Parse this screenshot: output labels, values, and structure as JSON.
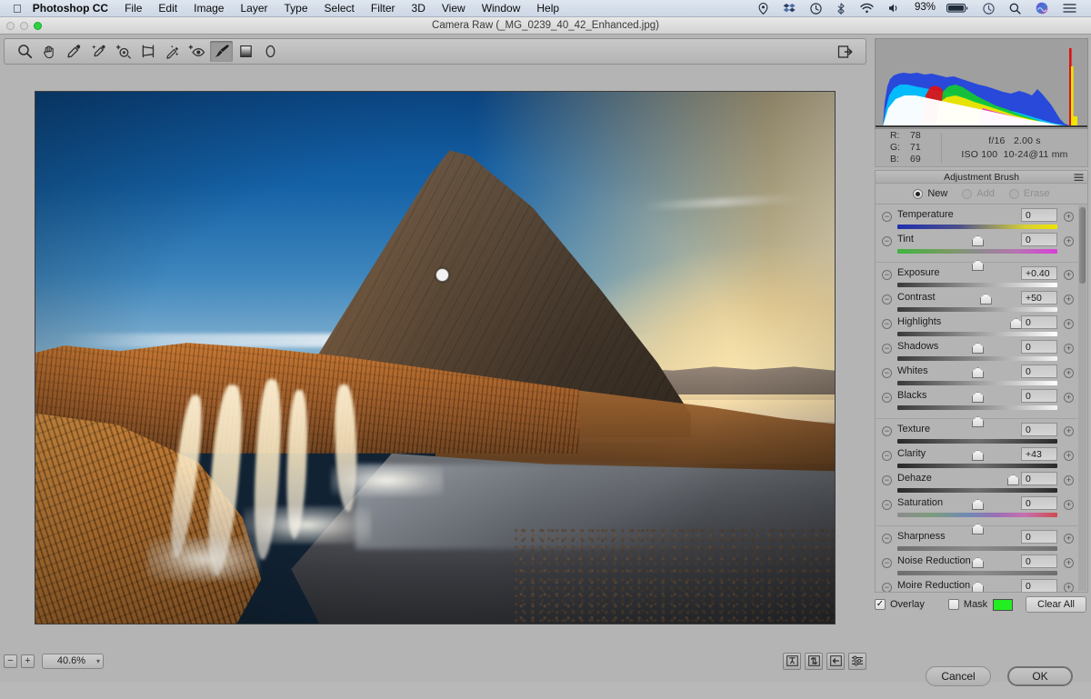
{
  "menubar": {
    "apple_icon": "apple-icon",
    "app_name": "Photoshop CC",
    "items": [
      "File",
      "Edit",
      "Image",
      "Layer",
      "Type",
      "Select",
      "Filter",
      "3D",
      "View",
      "Window",
      "Help"
    ],
    "status": {
      "battery_percent": "93%",
      "icons": [
        "location-icon",
        "dropbox-icon",
        "time-machine-icon",
        "bluetooth-icon",
        "wifi-icon",
        "volume-icon",
        "battery-icon",
        "clock-icon",
        "search-icon",
        "siri-icon",
        "control-center-icon"
      ]
    }
  },
  "window": {
    "title": "Camera Raw (_MG_0239_40_42_Enhanced.jpg)",
    "traffic_lights": [
      "close",
      "minimize",
      "zoom"
    ]
  },
  "toolbar": {
    "tools": [
      {
        "name": "zoom-tool",
        "selected": false
      },
      {
        "name": "hand-tool",
        "selected": false
      },
      {
        "name": "white-balance-tool",
        "selected": false
      },
      {
        "name": "color-sampler-tool",
        "selected": false
      },
      {
        "name": "targeted-adjustment-tool",
        "selected": false
      },
      {
        "name": "crop-tool",
        "selected": false
      },
      {
        "name": "spot-removal-tool",
        "selected": false
      },
      {
        "name": "red-eye-tool",
        "selected": false
      },
      {
        "name": "adjustment-brush-tool",
        "selected": true
      },
      {
        "name": "graduated-filter-tool",
        "selected": false
      },
      {
        "name": "radial-filter-tool",
        "selected": false
      }
    ],
    "preferences_icon": "open-preferences-icon"
  },
  "histogram": {
    "shadow_clip_icon": "shadow-clipping-triangle",
    "highlight_clip_icon": "highlight-clipping-triangle"
  },
  "exif": {
    "r_label": "R:",
    "r_value": "78",
    "g_label": "G:",
    "g_value": "71",
    "b_label": "B:",
    "b_value": "69",
    "aperture": "f/16",
    "shutter": "2.00 s",
    "iso": "ISO 100",
    "lens": "10-24@11 mm"
  },
  "panel": {
    "title": "Adjustment Brush",
    "menu_icon": "panel-menu-icon",
    "modes": [
      {
        "label": "New",
        "selected": true,
        "disabled": false
      },
      {
        "label": "Add",
        "selected": false,
        "disabled": true
      },
      {
        "label": "Erase",
        "selected": false,
        "disabled": true
      }
    ]
  },
  "sliders": [
    [
      {
        "label": "Temperature",
        "value": "0",
        "pos": 50,
        "track": "t-temp"
      },
      {
        "label": "Tint",
        "value": "0",
        "pos": 50,
        "track": "t-tint"
      }
    ],
    [
      {
        "label": "Exposure",
        "value": "+0.40",
        "pos": 55,
        "track": "t-gray"
      },
      {
        "label": "Contrast",
        "value": "+50",
        "pos": 74,
        "track": "t-gray2"
      },
      {
        "label": "Highlights",
        "value": "0",
        "pos": 50,
        "track": "t-gray"
      },
      {
        "label": "Shadows",
        "value": "0",
        "pos": 50,
        "track": "t-gray2"
      },
      {
        "label": "Whites",
        "value": "0",
        "pos": 50,
        "track": "t-gray"
      },
      {
        "label": "Blacks",
        "value": "0",
        "pos": 50,
        "track": "t-gray2"
      }
    ],
    [
      {
        "label": "Texture",
        "value": "0",
        "pos": 50,
        "track": "t-dark"
      },
      {
        "label": "Clarity",
        "value": "+43",
        "pos": 72,
        "track": "t-dark"
      },
      {
        "label": "Dehaze",
        "value": "0",
        "pos": 50,
        "track": "t-dark"
      },
      {
        "label": "Saturation",
        "value": "0",
        "pos": 50,
        "track": "t-sat"
      }
    ],
    [
      {
        "label": "Sharpness",
        "value": "0",
        "pos": 50,
        "track": "t-mid"
      },
      {
        "label": "Noise Reduction",
        "value": "0",
        "pos": 50,
        "track": "t-mid"
      },
      {
        "label": "Moire Reduction",
        "value": "0",
        "pos": 50,
        "track": "t-mid"
      }
    ]
  ],
  "slider_buttons": {
    "minus": "−",
    "plus": "+"
  },
  "overlay_row": {
    "overlay_label": "Overlay",
    "overlay_checked": true,
    "mask_label": "Mask",
    "mask_checked": false,
    "mask_color": "#22ee22",
    "clear_all_label": "Clear All"
  },
  "zoom_bar": {
    "minus_label": "−",
    "plus_label": "+",
    "level": "40.6%",
    "caret": "▾",
    "preview_buttons": [
      "before-after-preview-icon",
      "swap-before-after-icon",
      "copy-current-to-before-icon",
      "preview-preferences-icon"
    ]
  },
  "footer": {
    "cancel_label": "Cancel",
    "ok_label": "OK"
  },
  "photo": {
    "subject": "Kirkjufell mountain with waterfalls at sunset",
    "brush_pin": "adjustment-brush-pin"
  }
}
